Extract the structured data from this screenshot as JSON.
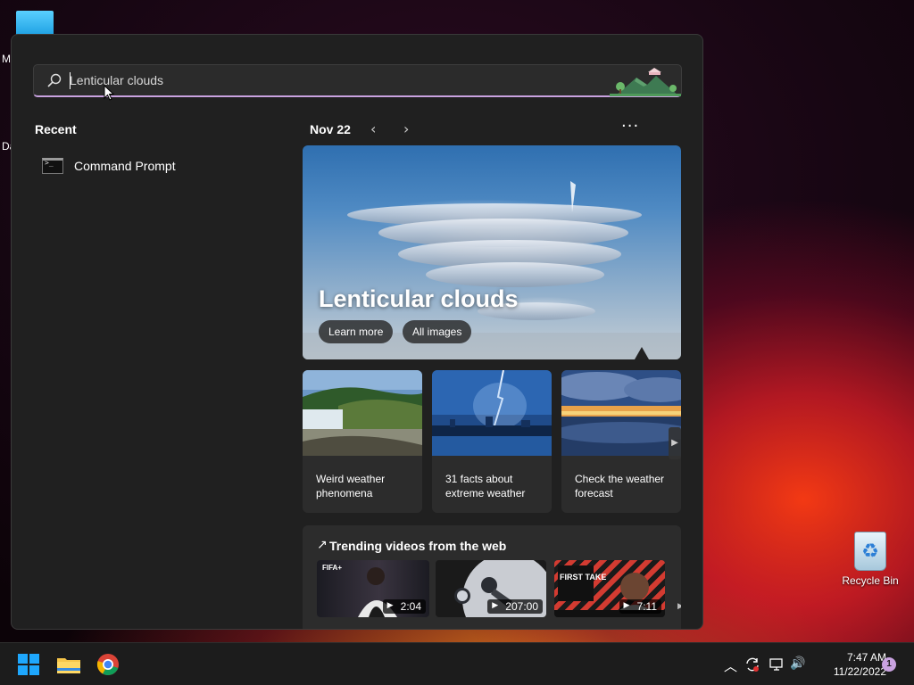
{
  "desktop": {
    "edge_letters": [
      "M",
      "Da"
    ],
    "recycle_bin_label": "Recycle Bin"
  },
  "search": {
    "query": "Lenticular clouds",
    "placeholder": "Lenticular clouds"
  },
  "recent": {
    "title": "Recent",
    "items": [
      {
        "label": "Command Prompt",
        "icon": "command-prompt-icon"
      }
    ]
  },
  "highlights": {
    "date": "Nov 22",
    "prev_glyph": "‹",
    "next_glyph": "›",
    "more_glyph": "···",
    "hero": {
      "title": "Lenticular clouds",
      "learn_more": "Learn more",
      "all_images": "All images"
    },
    "cards": [
      {
        "label": "Weird weather phenomena"
      },
      {
        "label": "31 facts about extreme weather"
      },
      {
        "label": "Check the weather forecast"
      }
    ],
    "card_next_glyph": "▶"
  },
  "trending": {
    "title": "Trending videos from the web",
    "icon_glyph": "↗",
    "videos": [
      {
        "duration": "2:04",
        "badge": "FIFA+"
      },
      {
        "duration": "207:00",
        "badge": ""
      },
      {
        "duration": "7:11",
        "badge": "FIRST TAKE"
      }
    ],
    "next_glyph": "▶"
  },
  "taskbar": {
    "time": "7:47 AM",
    "date": "11/22/2022",
    "notifications": "1",
    "tray_up_glyph": "︿",
    "volume_glyph": "🔊"
  },
  "colors": {
    "accent": "#c9a2e0",
    "panel_bg": "#202020",
    "card_bg": "#2c2c2c"
  }
}
